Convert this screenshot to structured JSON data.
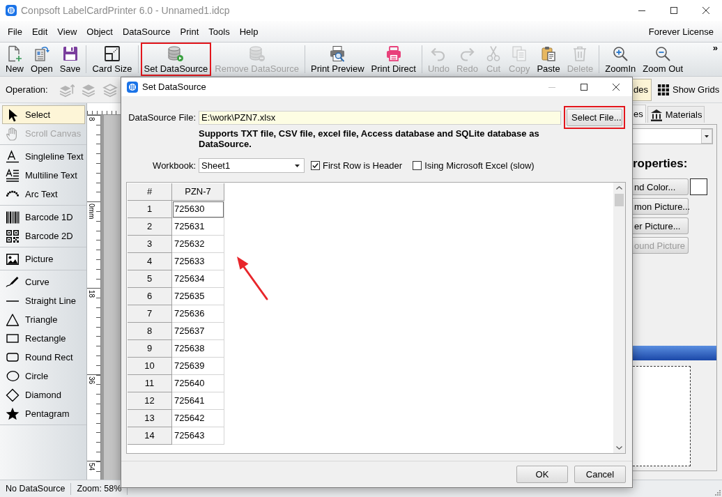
{
  "window": {
    "title": "Conpsoft LabelCardPrinter 6.0 - Unnamed1.idcp",
    "license": "Forever License"
  },
  "menu": [
    "File",
    "Edit",
    "View",
    "Object",
    "DataSource",
    "Print",
    "Tools",
    "Help"
  ],
  "toolbar": {
    "groups": [
      [
        {
          "label": "New",
          "disabled": false,
          "highlighted": false
        },
        {
          "label": "Open",
          "disabled": false,
          "highlighted": false
        },
        {
          "label": "Save",
          "disabled": false,
          "highlighted": false
        }
      ],
      [
        {
          "label": "Card Size",
          "disabled": false,
          "highlighted": false
        }
      ],
      [
        {
          "label": "Set DataSource",
          "disabled": false,
          "highlighted": true
        },
        {
          "label": "Remove DataSource",
          "disabled": true,
          "highlighted": false
        }
      ],
      [
        {
          "label": "Print Preview",
          "disabled": false,
          "highlighted": false
        },
        {
          "label": "Print Direct",
          "disabled": false,
          "highlighted": false
        }
      ],
      [
        {
          "label": "Undo",
          "disabled": true,
          "highlighted": false
        },
        {
          "label": "Redo",
          "disabled": true,
          "highlighted": false
        },
        {
          "label": "Cut",
          "disabled": true,
          "highlighted": false
        },
        {
          "label": "Copy",
          "disabled": true,
          "highlighted": false
        },
        {
          "label": "Paste",
          "disabled": false,
          "highlighted": false
        },
        {
          "label": "Delete",
          "disabled": true,
          "highlighted": false
        }
      ],
      [
        {
          "label": "ZoomIn",
          "disabled": false,
          "highlighted": false
        },
        {
          "label": "Zoom Out",
          "disabled": false,
          "highlighted": false
        }
      ]
    ],
    "overflow": "»"
  },
  "operation_bar": {
    "label": "Operation:",
    "buttons": [
      {
        "disabled": true
      },
      {
        "disabled": true
      },
      {
        "disabled": true
      }
    ],
    "toggles": [
      {
        "label": "des",
        "on": true
      },
      {
        "label": "Show Grids",
        "on": false
      }
    ]
  },
  "tools": {
    "groups": [
      [
        {
          "label": "Select",
          "selected": true,
          "disabled": false
        },
        {
          "label": "Scroll Canvas",
          "selected": false,
          "disabled": true
        }
      ],
      [
        {
          "label": "Singleline Text",
          "selected": false,
          "disabled": false
        },
        {
          "label": "Multiline Text",
          "selected": false,
          "disabled": false
        },
        {
          "label": "Arc Text",
          "selected": false,
          "disabled": false
        }
      ],
      [
        {
          "label": "Barcode 1D",
          "selected": false,
          "disabled": false
        },
        {
          "label": "Barcode 2D",
          "selected": false,
          "disabled": false
        }
      ],
      [
        {
          "label": "Picture",
          "selected": false,
          "disabled": false
        }
      ],
      [
        {
          "label": "Curve",
          "selected": false,
          "disabled": false
        },
        {
          "label": "Straight Line",
          "selected": false,
          "disabled": false
        },
        {
          "label": "Triangle",
          "selected": false,
          "disabled": false
        },
        {
          "label": "Rectangle",
          "selected": false,
          "disabled": false
        },
        {
          "label": "Round Rect",
          "selected": false,
          "disabled": false
        },
        {
          "label": "Circle",
          "selected": false,
          "disabled": false
        },
        {
          "label": "Diamond",
          "selected": false,
          "disabled": false
        },
        {
          "label": "Pentagram",
          "selected": false,
          "disabled": false
        }
      ]
    ]
  },
  "ruler": {
    "labels": [
      "8",
      "0mm",
      "18",
      "36",
      "54"
    ]
  },
  "right_panel": {
    "tabs": [
      {
        "label": "es",
        "selected": true
      },
      {
        "label": "Materials",
        "selected": false
      }
    ],
    "heading": "roperties:",
    "buttons": [
      {
        "label": "nd Color...",
        "disabled": false
      },
      {
        "label": "mon Picture...",
        "disabled": false
      },
      {
        "label": "er Picture...",
        "disabled": false
      },
      {
        "label": "ound Picture",
        "disabled": true
      }
    ]
  },
  "dialog": {
    "title": "Set DataSource",
    "controls": [
      {
        "kind": "minimize",
        "disabled": true
      },
      {
        "kind": "maximize",
        "disabled": false
      },
      {
        "kind": "close",
        "disabled": false
      }
    ],
    "file_label": "DataSource File:",
    "file_path": "E:\\work\\PZN7.xlsx",
    "select_button": {
      "label": "Select File...",
      "highlighted": true
    },
    "note": "Supports TXT file, CSV file, excel file, Access database and SQLite database as DataSource.",
    "workbook_label": "Workbook:",
    "workbook": "Sheet1",
    "options": [
      {
        "label": "First Row is Header",
        "checked": true
      },
      {
        "label": "Ising Microsoft Excel (slow)",
        "checked": false
      }
    ],
    "table": {
      "columns": [
        "#",
        "PZN-7"
      ],
      "rows": [
        {
          "cells": [
            "1",
            "725630"
          ],
          "selected": true
        },
        {
          "cells": [
            "2",
            "725631"
          ],
          "selected": false
        },
        {
          "cells": [
            "3",
            "725632"
          ],
          "selected": false
        },
        {
          "cells": [
            "4",
            "725633"
          ],
          "selected": false
        },
        {
          "cells": [
            "5",
            "725634"
          ],
          "selected": false
        },
        {
          "cells": [
            "6",
            "725635"
          ],
          "selected": false
        },
        {
          "cells": [
            "7",
            "725636"
          ],
          "selected": false
        },
        {
          "cells": [
            "8",
            "725637"
          ],
          "selected": false
        },
        {
          "cells": [
            "9",
            "725638"
          ],
          "selected": false
        },
        {
          "cells": [
            "10",
            "725639"
          ],
          "selected": false
        },
        {
          "cells": [
            "11",
            "725640"
          ],
          "selected": false
        },
        {
          "cells": [
            "12",
            "725641"
          ],
          "selected": false
        },
        {
          "cells": [
            "13",
            "725642"
          ],
          "selected": false
        },
        {
          "cells": [
            "14",
            "725643"
          ],
          "selected": false
        }
      ]
    },
    "buttons": [
      "OK",
      "Cancel"
    ]
  },
  "status_bar": [
    "No DataSource",
    "Zoom: 58%"
  ]
}
